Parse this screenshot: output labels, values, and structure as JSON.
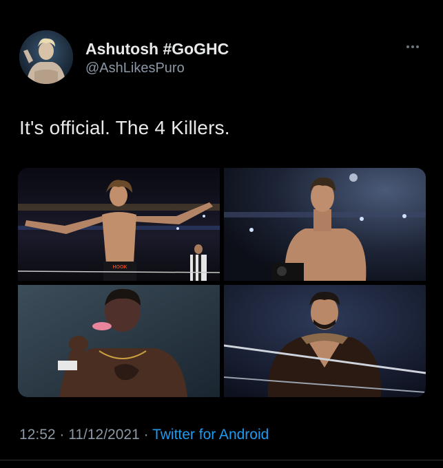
{
  "tweet": {
    "author_name": "Ashutosh #GoGHC",
    "author_handle": "@AshLikesPuro",
    "text": "It's official. The 4 Killers.",
    "time": "12:52",
    "separator": " · ",
    "date": "11/12/2021",
    "source": "Twitter for Android"
  },
  "media": {
    "photo_1_trunks_text": "HOOK"
  },
  "colors": {
    "background": "#000000",
    "text_primary": "#e7e9ea",
    "text_secondary": "#8b98a5",
    "link": "#1d9bf0"
  },
  "icons": {
    "more": "more-options-icon"
  }
}
